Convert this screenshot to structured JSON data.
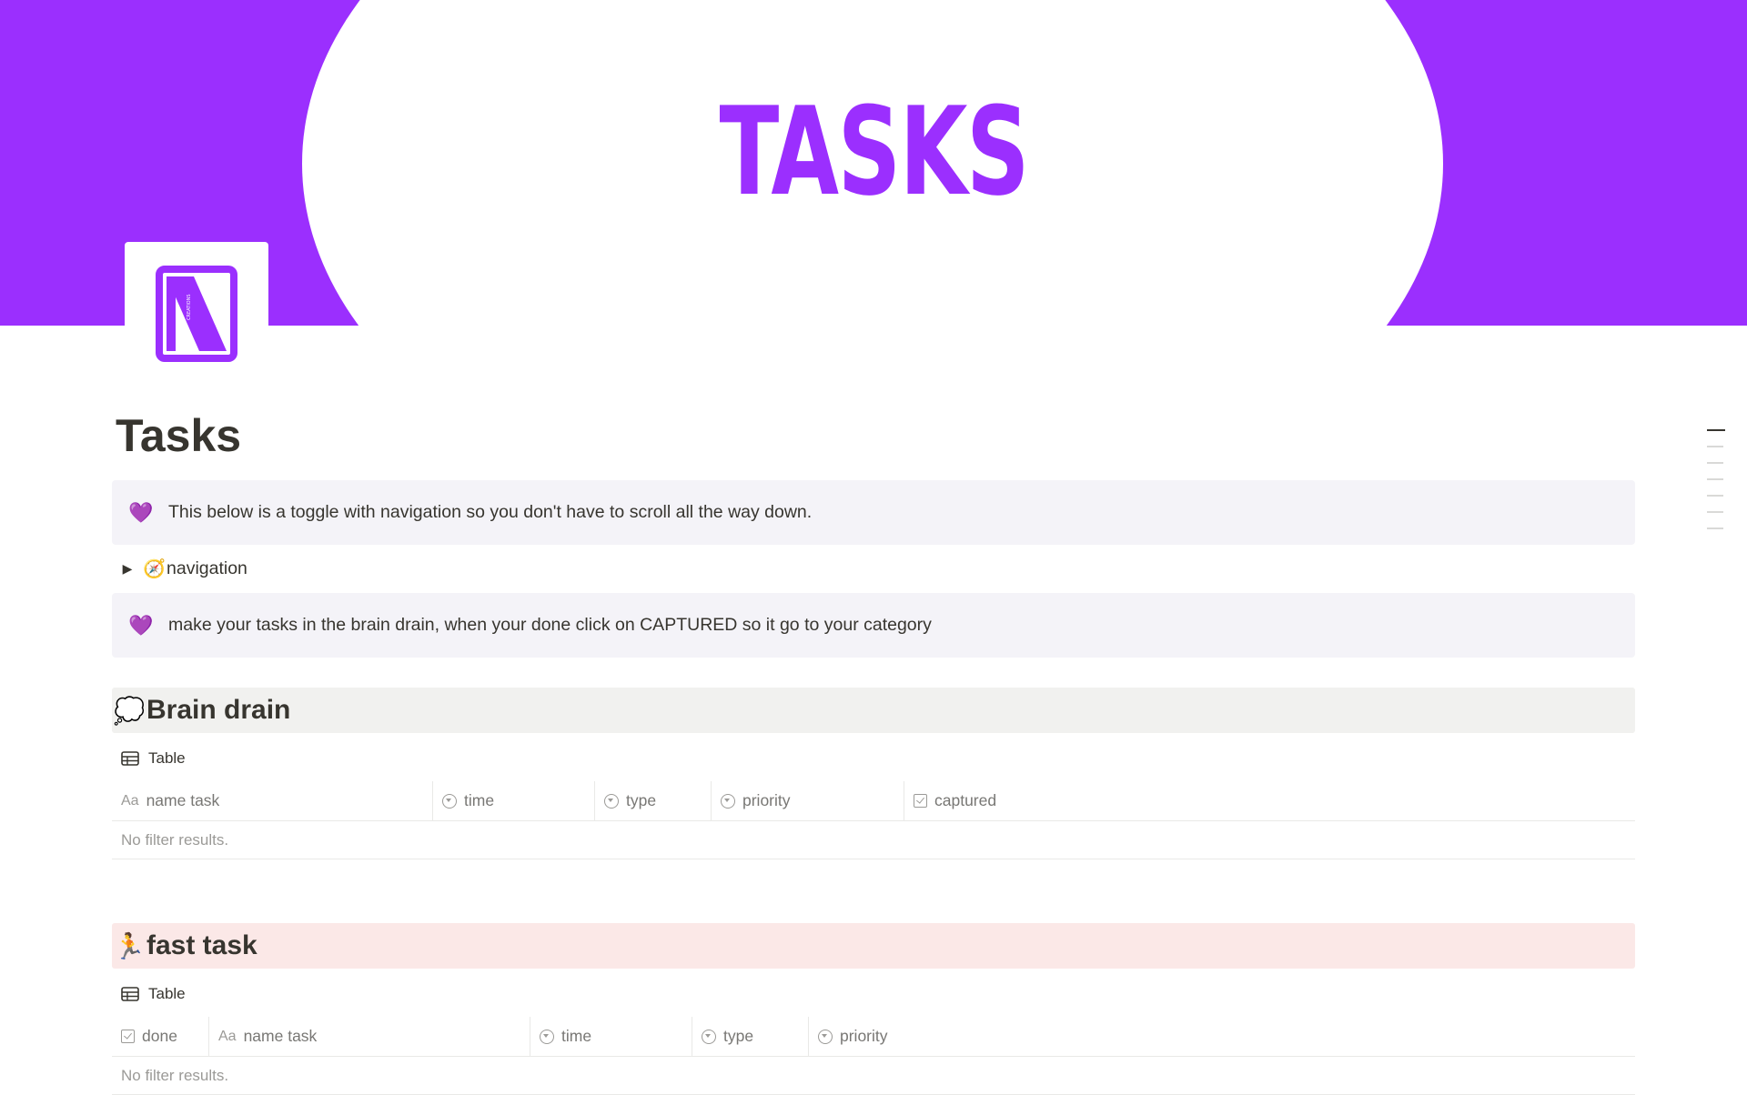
{
  "cover": {
    "title": "TASKS",
    "background_color": "#9b2ffe",
    "accent_color": "#9b2ffe"
  },
  "page_icon": {
    "icon": "logo-icon",
    "logo_text": "CREATIONS"
  },
  "page_title": "Tasks",
  "callouts": [
    {
      "emoji": "💜",
      "text": "This below is a toggle with navigation so you don't have to scroll all the way down."
    },
    {
      "emoji": "💜",
      "text": "make your tasks in the brain drain, when your done click on CAPTURED so it go to your category"
    }
  ],
  "toggle": {
    "emoji": "🧭",
    "label": "navigation"
  },
  "sections": [
    {
      "emoji": "💭",
      "title": "Brain drain",
      "background": "#f1f1ef",
      "view_label": "Table",
      "columns": [
        {
          "icon": "Aa",
          "label": "name task"
        },
        {
          "icon": "select-icon",
          "label": "time"
        },
        {
          "icon": "select-icon",
          "label": "type"
        },
        {
          "icon": "select-icon",
          "label": "priority"
        },
        {
          "icon": "checkbox-icon",
          "label": "captured"
        }
      ],
      "empty_text": "No filter results."
    },
    {
      "emoji": "🏃",
      "title": "fast task",
      "background": "#fbe8e7",
      "view_label": "Table",
      "columns": [
        {
          "icon": "checkbox-icon",
          "label": "done"
        },
        {
          "icon": "Aa",
          "label": "name task"
        },
        {
          "icon": "select-icon",
          "label": "time"
        },
        {
          "icon": "select-icon",
          "label": "type"
        },
        {
          "icon": "select-icon",
          "label": "priority"
        }
      ],
      "empty_text": "No filter results."
    }
  ]
}
